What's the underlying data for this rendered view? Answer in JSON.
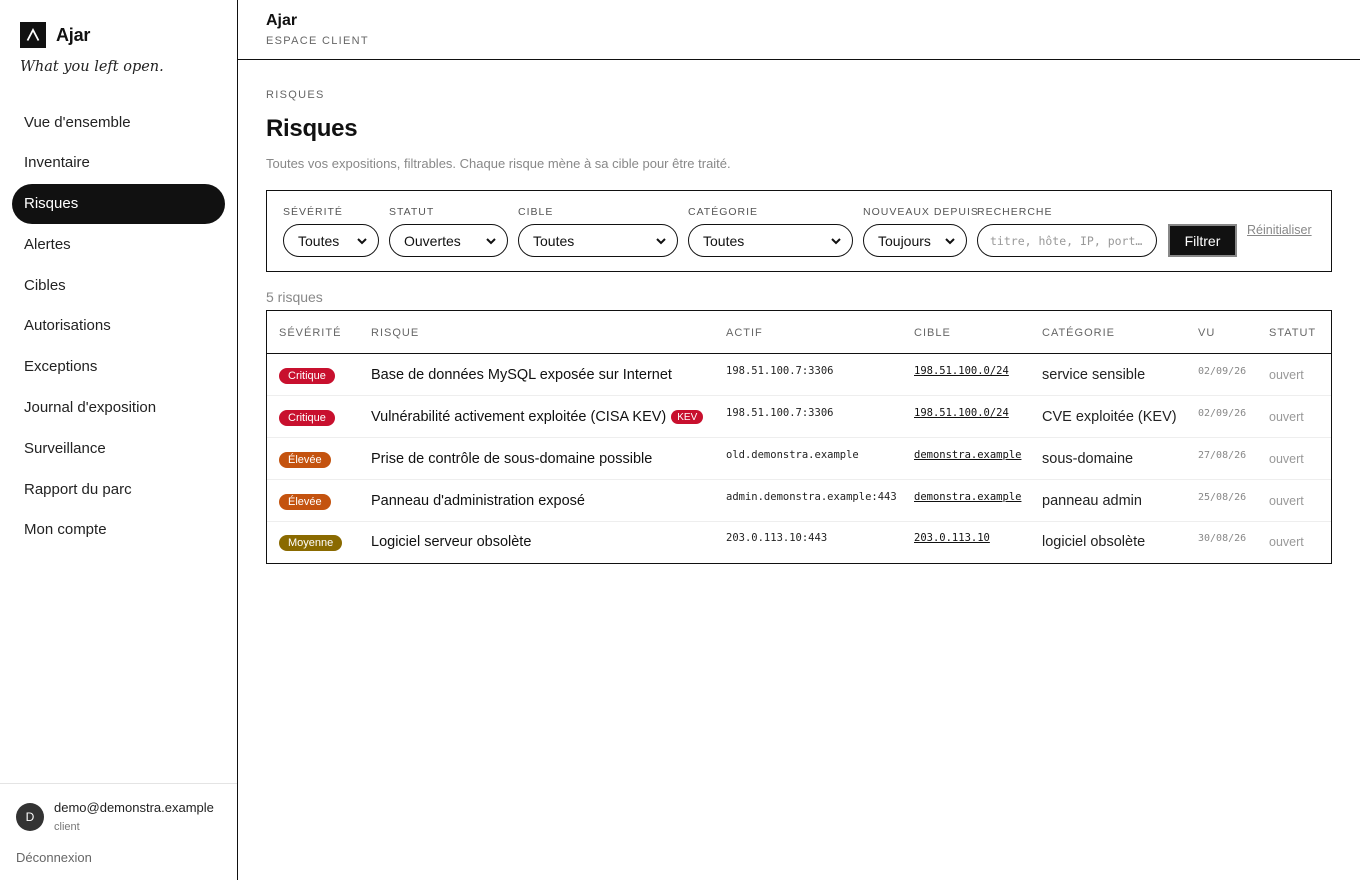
{
  "app": {
    "brand": "Ajar",
    "tagline": "What you left open.",
    "header_title": "Ajar",
    "header_subtitle": "ESPACE CLIENT"
  },
  "sidebar": {
    "items": [
      {
        "label": "Vue d'ensemble",
        "active": false
      },
      {
        "label": "Inventaire",
        "active": false
      },
      {
        "label": "Risques",
        "active": true
      },
      {
        "label": "Alertes",
        "active": false
      },
      {
        "label": "Cibles",
        "active": false
      },
      {
        "label": "Autorisations",
        "active": false
      },
      {
        "label": "Exceptions",
        "active": false
      },
      {
        "label": "Journal d'exposition",
        "active": false
      },
      {
        "label": "Surveillance",
        "active": false
      },
      {
        "label": "Rapport du parc",
        "active": false
      },
      {
        "label": "Mon compte",
        "active": false
      }
    ],
    "user": {
      "initial": "D",
      "email": "demo@demonstra.example",
      "role": "client"
    },
    "logout": "Déconnexion"
  },
  "page": {
    "eyebrow": "RISQUES",
    "title": "Risques",
    "description": "Toutes vos expositions, filtrables. Chaque risque mène à sa cible pour être traité."
  },
  "filters": {
    "severity": {
      "label": "SÉVÉRITÉ",
      "value": "Toutes"
    },
    "status": {
      "label": "STATUT",
      "value": "Ouvertes"
    },
    "target": {
      "label": "CIBLE",
      "value": "Toutes"
    },
    "category": {
      "label": "CATÉGORIE",
      "value": "Toutes"
    },
    "since": {
      "label": "NOUVEAUX DEPUIS",
      "value": "Toujours"
    },
    "search": {
      "label": "RECHERCHE",
      "placeholder": "titre, hôte, IP, port…"
    },
    "submit": "Filtrer",
    "reset": "Réinitialiser"
  },
  "results": {
    "count": "5 risques"
  },
  "table": {
    "headers": {
      "severity": "SÉVÉRITÉ",
      "risk": "RISQUE",
      "asset": "ACTIF",
      "target": "CIBLE",
      "category": "CATÉGORIE",
      "seen": "VU",
      "status": "STATUT"
    },
    "rows": [
      {
        "severity": "Critique",
        "severity_color": "#c8102e",
        "title": "Base de données MySQL exposée sur Internet",
        "kev": "",
        "asset": "198.51.100.7:3306",
        "target": "198.51.100.0/24",
        "category": "service sensible",
        "seen": "02/09/26",
        "status": "ouvert"
      },
      {
        "severity": "Critique",
        "severity_color": "#c8102e",
        "title": "Vulnérabilité activement exploitée (CISA KEV)",
        "kev": "KEV",
        "asset": "198.51.100.7:3306",
        "target": "198.51.100.0/24",
        "category": "CVE exploitée (KEV)",
        "seen": "02/09/26",
        "status": "ouvert"
      },
      {
        "severity": "Élevée",
        "severity_color": "#c4530f",
        "title": "Prise de contrôle de sous-domaine possible",
        "kev": "",
        "asset": "old.demonstra.example",
        "target": "demonstra.example",
        "category": "sous-domaine",
        "seen": "27/08/26",
        "status": "ouvert"
      },
      {
        "severity": "Élevée",
        "severity_color": "#c4530f",
        "title": "Panneau d'administration exposé",
        "kev": "",
        "asset": "admin.demonstra.example:443",
        "target": "demonstra.example",
        "category": "panneau admin",
        "seen": "25/08/26",
        "status": "ouvert"
      },
      {
        "severity": "Moyenne",
        "severity_color": "#8a6a00",
        "title": "Logiciel serveur obsolète",
        "kev": "",
        "asset": "203.0.113.10:443",
        "target": "203.0.113.10",
        "category": "logiciel obsolète",
        "seen": "30/08/26",
        "status": "ouvert"
      }
    ]
  }
}
